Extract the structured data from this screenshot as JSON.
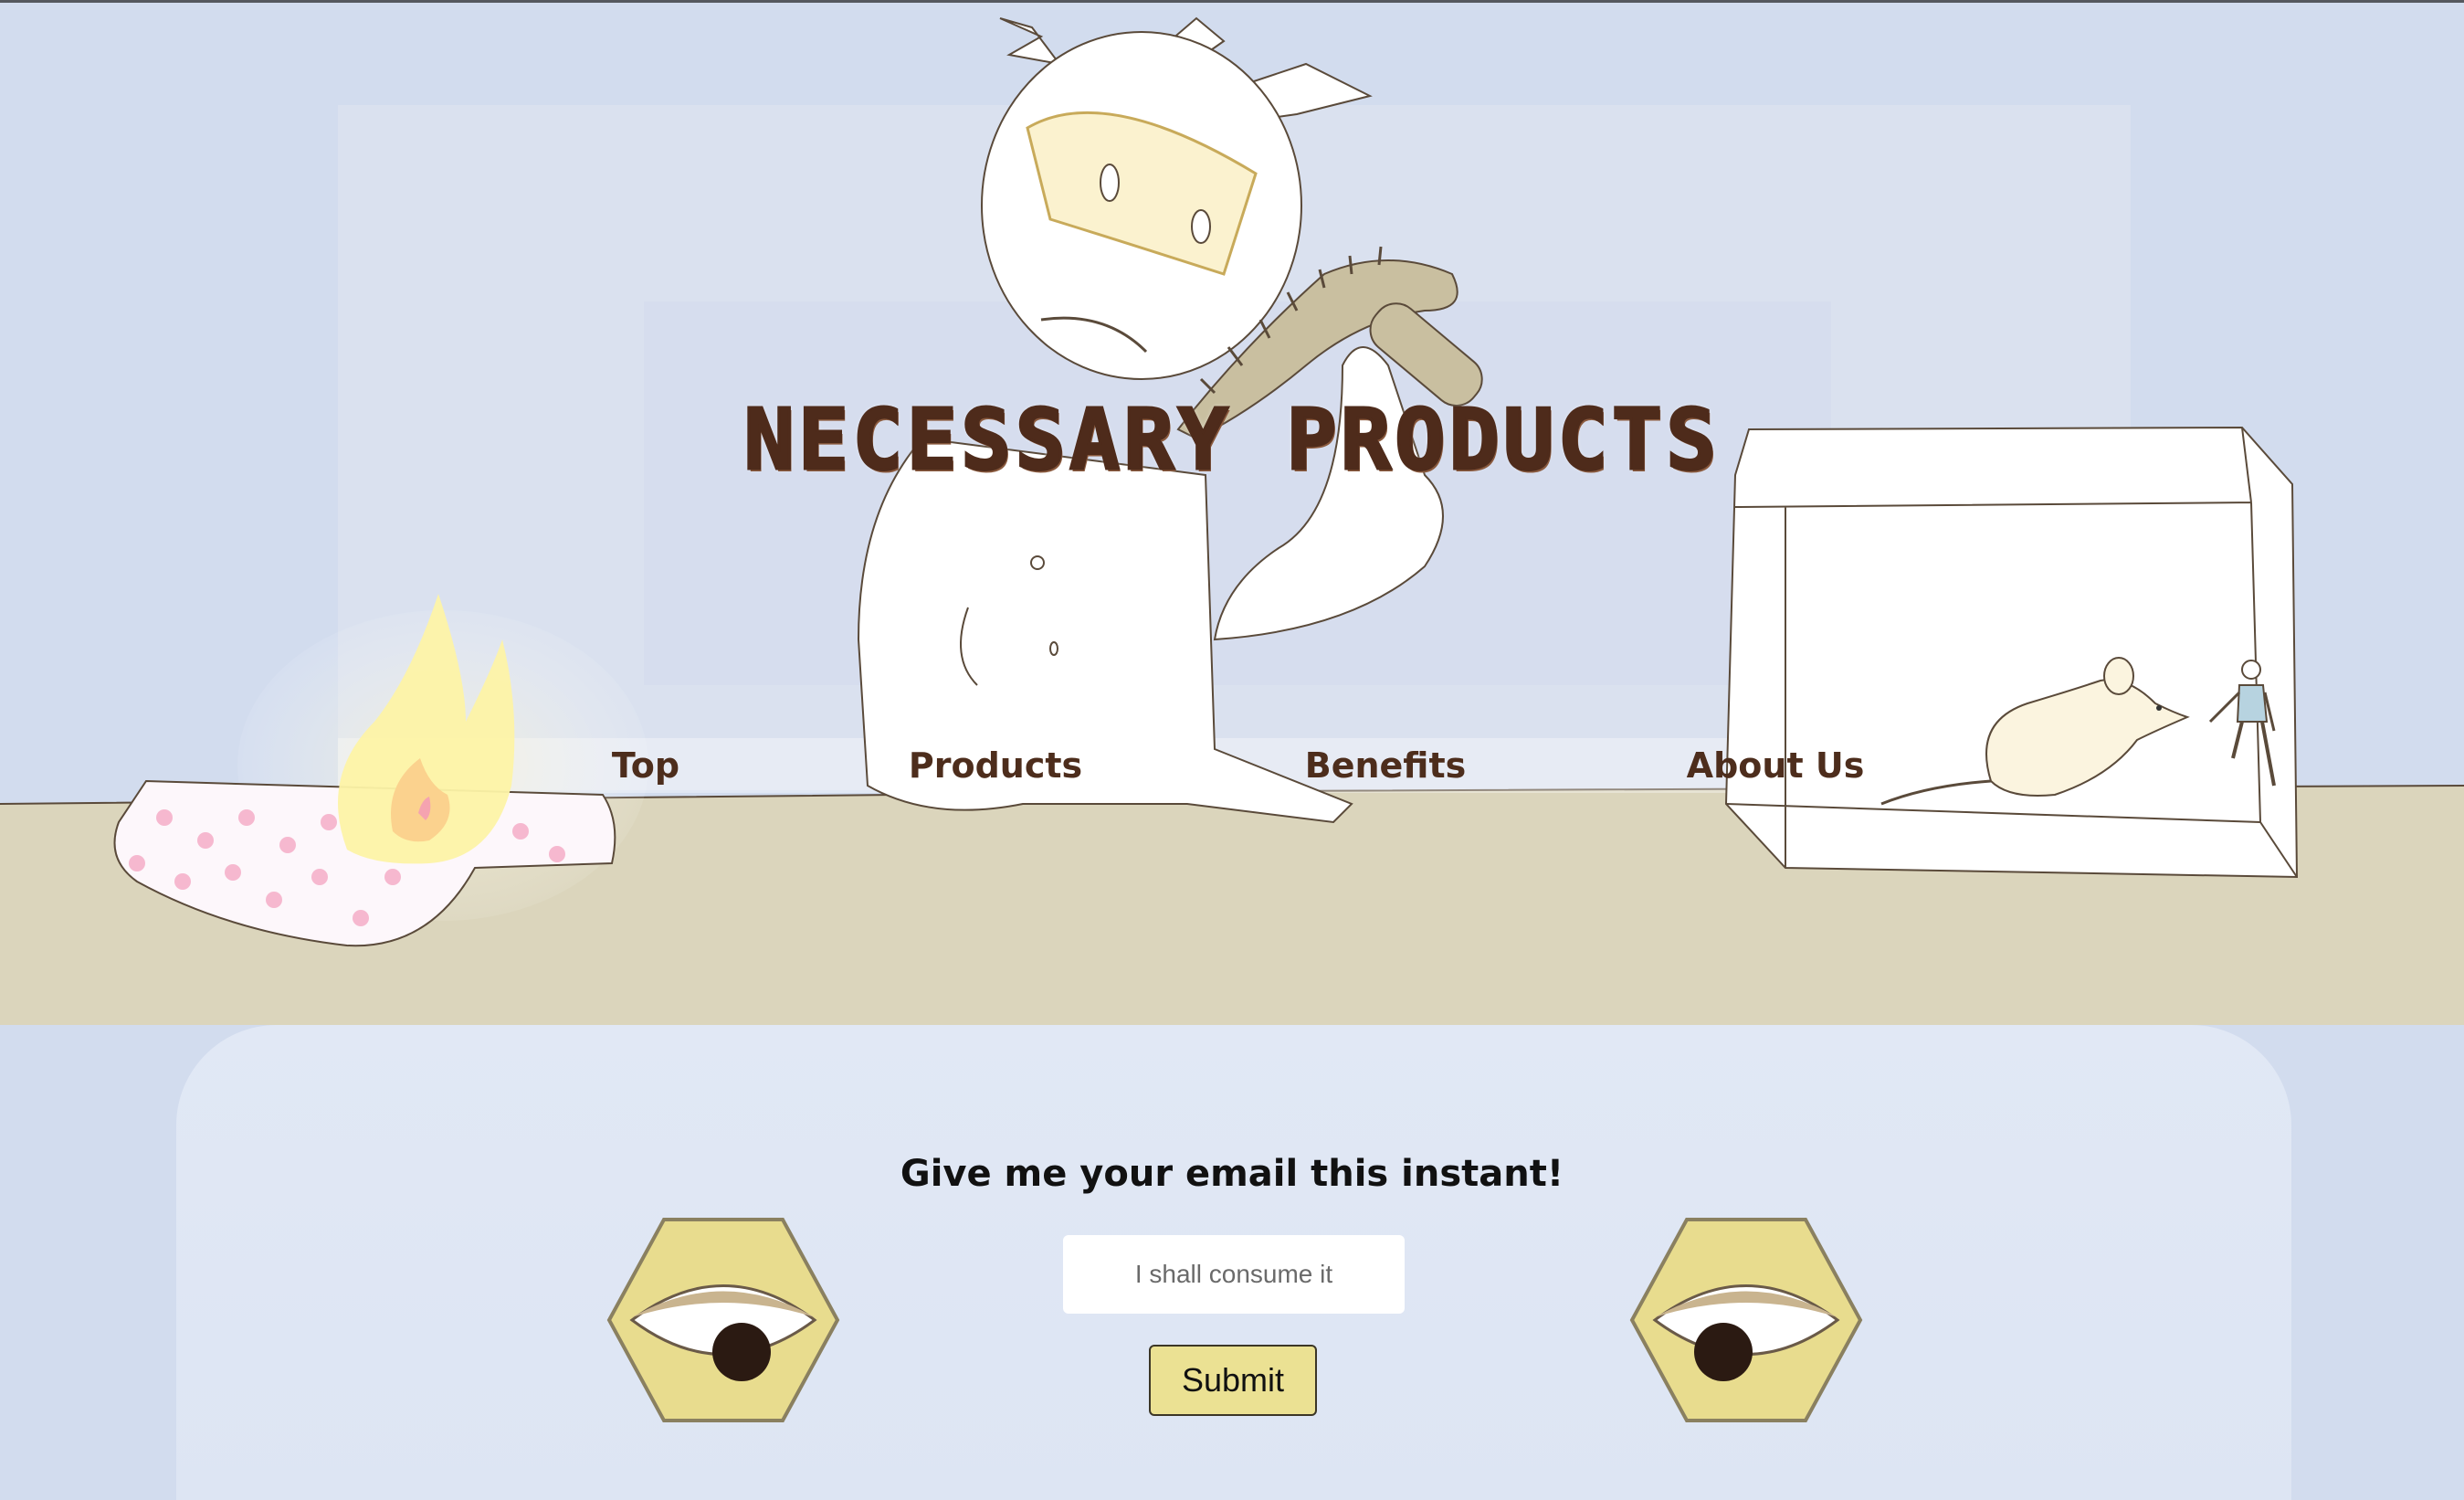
{
  "header": {
    "title": "NECESSARY PRODUCTS"
  },
  "nav": {
    "items": [
      {
        "label": "Top"
      },
      {
        "label": "Products"
      },
      {
        "label": "Benefits"
      },
      {
        "label": "About Us"
      }
    ]
  },
  "signup": {
    "heading": "Give me your email this instant!",
    "email_placeholder": "I shall consume it",
    "email_value": "",
    "submit_label": "Submit"
  },
  "colors": {
    "background": "#d2dcee",
    "table": "#dbd5bc",
    "title": "#4e2b1b",
    "button": "#ebe193",
    "eye_hexagon": "#e8dc8e"
  },
  "icons": {
    "scientist": "scientist-illustration",
    "shoe": "spiked-shoe-illustration",
    "fire": "fire-icon",
    "socks": "sock-illustration",
    "tank": "glass-tank-illustration",
    "mouse": "mouse-illustration",
    "eyes": "eye-icon"
  }
}
